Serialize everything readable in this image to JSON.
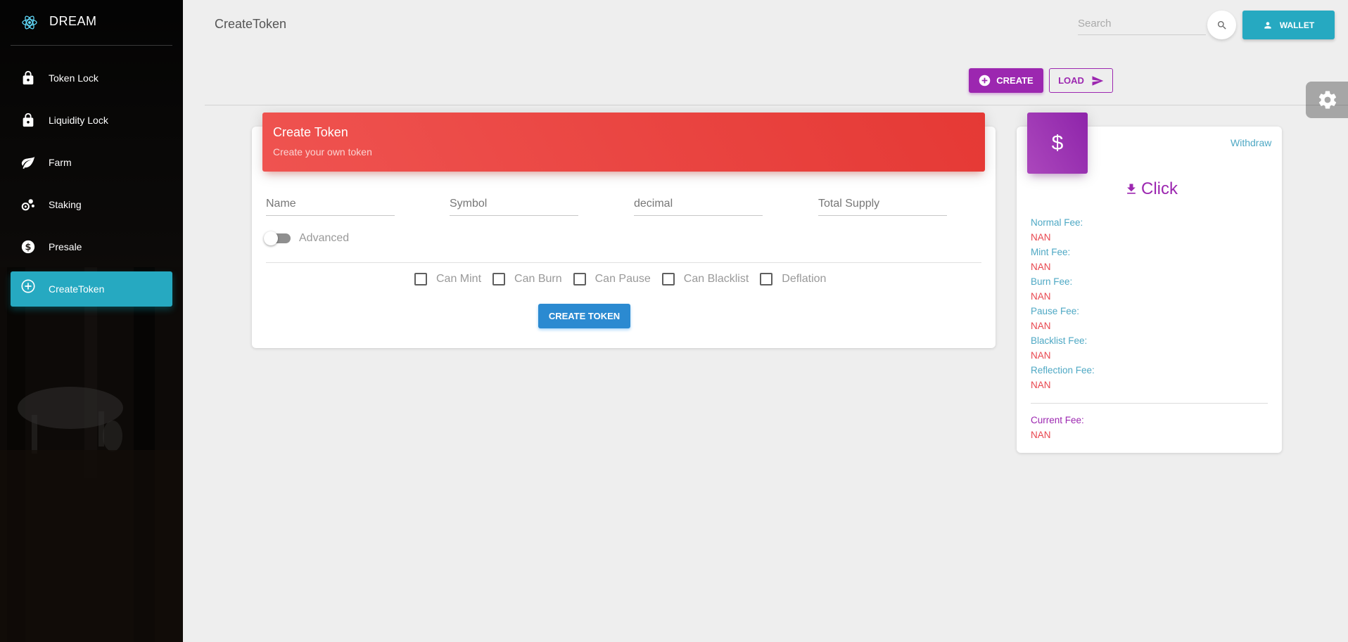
{
  "app": {
    "brand": "DREAM",
    "page_title": "CreateToken"
  },
  "sidebar": {
    "items": [
      {
        "label": "Token Lock",
        "icon": "lock-icon",
        "active": false
      },
      {
        "label": "Liquidity Lock",
        "icon": "lock-icon",
        "active": false
      },
      {
        "label": "Farm",
        "icon": "leaf-icon",
        "active": false
      },
      {
        "label": "Staking",
        "icon": "coins-icon",
        "active": false
      },
      {
        "label": "Presale",
        "icon": "dollar-circle-icon",
        "active": false
      },
      {
        "label": "CreateToken",
        "icon": "plus-circle-icon",
        "active": true
      }
    ]
  },
  "header": {
    "search_placeholder": "Search",
    "wallet_label": "WALLET",
    "create_label": "CREATE",
    "load_label": "LOAD"
  },
  "create_card": {
    "title": "Create Token",
    "subtitle": "Create your own token",
    "fields": {
      "name_placeholder": "Name",
      "symbol_placeholder": "Symbol",
      "decimal_placeholder": "decimal",
      "total_supply_placeholder": "Total Supply"
    },
    "advanced_label": "Advanced",
    "advanced_on": false,
    "options": [
      "Can Mint",
      "Can Burn",
      "Can Pause",
      "Can Blacklist",
      "Deflation"
    ],
    "submit_label": "CREATE TOKEN"
  },
  "fee_card": {
    "icon_symbol": "$",
    "withdraw_label": "Withdraw",
    "click_label": "Click",
    "fees": [
      {
        "label": "Normal Fee:",
        "value": "NAN"
      },
      {
        "label": "Mint Fee:",
        "value": "NAN"
      },
      {
        "label": "Burn Fee:",
        "value": "NAN"
      },
      {
        "label": "Pause Fee:",
        "value": "NAN"
      },
      {
        "label": "Blacklist Fee:",
        "value": "NAN"
      },
      {
        "label": "Reflection Fee:",
        "value": "NAN"
      }
    ],
    "current_fee_label": "Current Fee:",
    "current_fee_value": "NAN"
  },
  "colors": {
    "accent_cyan": "#26a9c1",
    "purple": "#9c27b0",
    "red": "#e53935",
    "blue": "#2b8ad1"
  }
}
